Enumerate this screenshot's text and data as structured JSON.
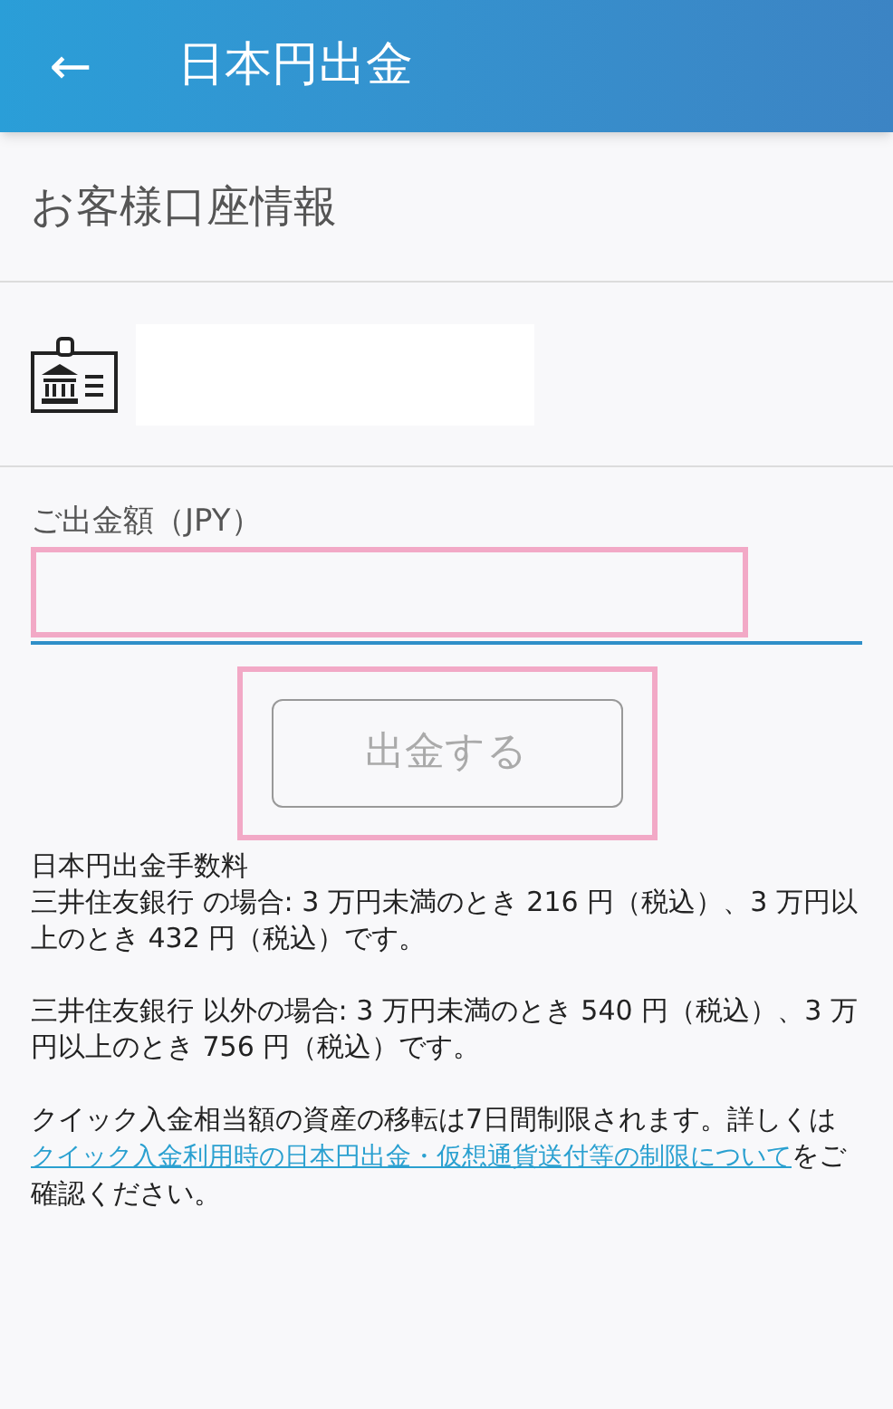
{
  "header": {
    "back": "←",
    "title": "日本円出金"
  },
  "account_section": {
    "title": "お客様口座情報"
  },
  "amount_field": {
    "label": "ご出金額（JPY）",
    "highlighted": true
  },
  "submit_button": {
    "label": "出金する",
    "disabled": true,
    "highlighted": true
  },
  "fee_info": {
    "title": "日本円出金手数料",
    "paragraphs": [
      "三井住友銀行 の場合: 3 万円未満のとき 216 円（税込）、3 万円以上のとき 432 円（税込）です。",
      "三井住友銀行 以外の場合: 3 万円未満のとき 540 円（税込）、3 万円以上のとき 756 円（税込）です。"
    ]
  },
  "notice": {
    "before": "クイック入金相当額の資産の移転は7日間制限されます。詳しくは",
    "link": "クイック入金利用時の日本円出金・仮想通貨送付等の制限について",
    "after": "をご確認ください。"
  }
}
